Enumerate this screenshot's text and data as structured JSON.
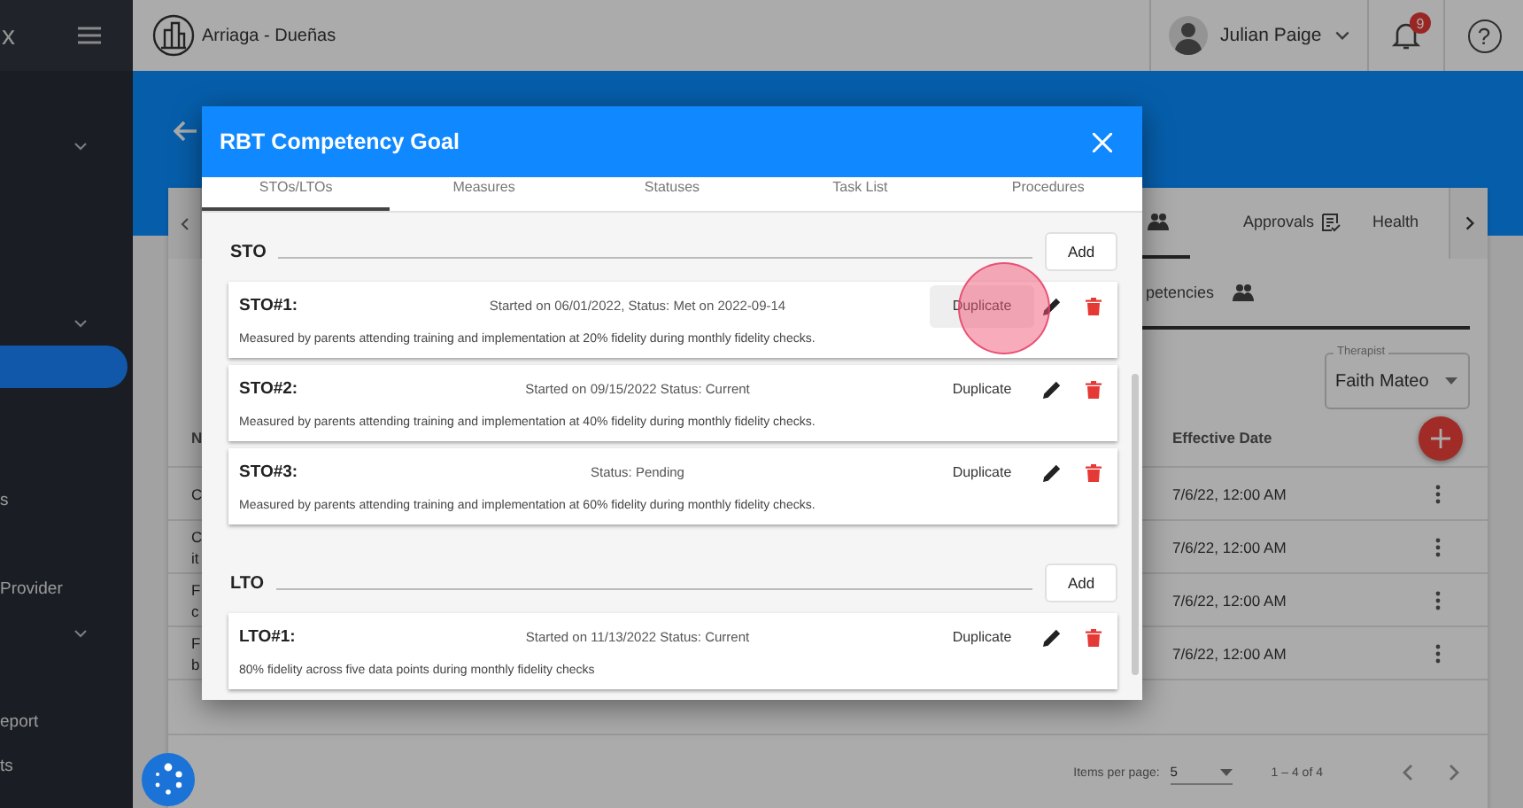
{
  "sidebar": {
    "brand": "x",
    "items": [
      {
        "expandable": true,
        "selected": false
      },
      {
        "expandable": true,
        "selected": false
      },
      {
        "expandable": false,
        "selected": true
      },
      {
        "label": "s",
        "expandable": false,
        "selected": false
      },
      {
        "label": "Provider",
        "expandable": false,
        "selected": false
      },
      {
        "expandable": true,
        "selected": false
      },
      {
        "label": "eport",
        "expandable": false,
        "selected": false
      },
      {
        "label": "ts",
        "expandable": false,
        "selected": false
      }
    ]
  },
  "topbar": {
    "organization": "Arriaga - Dueñas",
    "user": "Julian Paige",
    "notification_count": "9",
    "help": "?"
  },
  "card": {
    "tabs": [
      {
        "selected": true
      },
      {
        "label": "Approvals",
        "selected": false
      },
      {
        "label": "Health",
        "selected": false
      }
    ],
    "subtabs": [
      {
        "label": "petencies",
        "selected": true
      }
    ],
    "therapist": {
      "label": "Therapist",
      "value": "Faith Mateo"
    },
    "table": {
      "columns": [
        "N",
        "Effective Date"
      ],
      "rows": [
        {
          "column_1": [
            "C"
          ],
          "effective_date": "7/6/22, 12:00 AM"
        },
        {
          "column_1": [
            "C",
            "it"
          ],
          "effective_date": "7/6/22, 12:00 AM"
        },
        {
          "column_1": [
            "F",
            "c"
          ],
          "effective_date": "7/6/22, 12:00 AM"
        },
        {
          "column_1": [
            "F",
            "b"
          ],
          "effective_date": "7/6/22, 12:00 AM"
        }
      ]
    },
    "paginator": {
      "items_per_page_label": "Items per page:",
      "page_size": "5",
      "range": "1 – 4 of 4"
    }
  },
  "modal": {
    "title": "RBT Competency Goal",
    "tabs": [
      {
        "label": "STOs/LTOs",
        "selected": true
      },
      {
        "label": "Measures",
        "selected": false
      },
      {
        "label": "Statuses",
        "selected": false
      },
      {
        "label": "Task List",
        "selected": false
      },
      {
        "label": "Procedures",
        "selected": false
      }
    ],
    "sections": [
      {
        "heading": "STO",
        "add_label": "Add",
        "items": [
          {
            "title": "STO#1:",
            "status": "Started on 06/01/2022, Status: Met on 2022-09-14",
            "description": "Measured by parents attending training and implementation at 20% fidelity during monthly fidelity checks.",
            "duplicate_label": "Duplicate",
            "hovered": true
          },
          {
            "title": "STO#2:",
            "status": "Started on 09/15/2022 Status: Current",
            "description": "Measured by parents attending training and implementation at 40% fidelity during monthly fidelity checks.",
            "duplicate_label": "Duplicate",
            "hovered": false
          },
          {
            "title": "STO#3:",
            "status": "Status: Pending",
            "description": "Measured by parents attending training and implementation at 60% fidelity during monthly fidelity checks.",
            "duplicate_label": "Duplicate",
            "hovered": false
          }
        ]
      },
      {
        "heading": "LTO",
        "add_label": "Add",
        "items": [
          {
            "title": "LTO#1:",
            "status": "Started on 11/13/2022 Status: Current",
            "description": "80% fidelity across five data points during monthly fidelity checks",
            "duplicate_label": "Duplicate",
            "hovered": false
          }
        ]
      }
    ]
  }
}
